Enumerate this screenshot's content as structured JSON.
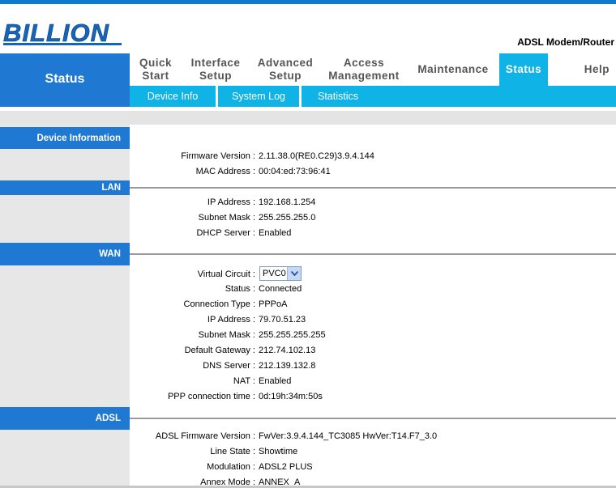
{
  "brand": {
    "logo_text": "BILLION",
    "tagline": "ADSL Modem/Router"
  },
  "nav": {
    "current": "Status",
    "items": [
      {
        "label": "Quick\nStart"
      },
      {
        "label": "Interface\nSetup"
      },
      {
        "label": "Advanced\nSetup"
      },
      {
        "label": "Access\nManagement"
      },
      {
        "label": "Maintenance"
      },
      {
        "label": "Status",
        "active": true
      },
      {
        "label": "Help"
      }
    ],
    "sub": [
      "Device Info",
      "System Log",
      "Statistics"
    ]
  },
  "sections": {
    "device": {
      "title": "Device Information",
      "rows": [
        {
          "label": "Firmware Version :",
          "value": "2.11.38.0(RE0.C29)3.9.4.144"
        },
        {
          "label": "MAC Address :",
          "value": "00:04:ed:73:96:41"
        }
      ]
    },
    "lan": {
      "title": "LAN",
      "rows": [
        {
          "label": "IP Address :",
          "value": "192.168.1.254"
        },
        {
          "label": "Subnet Mask :",
          "value": "255.255.255.0"
        },
        {
          "label": "DHCP Server :",
          "value": "Enabled"
        }
      ]
    },
    "wan": {
      "title": "WAN",
      "virtual_circuit_label": "Virtual Circuit :",
      "virtual_circuit_value": "PVC0",
      "rows": [
        {
          "label": "Status :",
          "value": "Connected"
        },
        {
          "label": "Connection Type :",
          "value": "PPPoA"
        },
        {
          "label": "IP Address :",
          "value": "79.70.51.23"
        },
        {
          "label": "Subnet Mask :",
          "value": "255.255.255.255"
        },
        {
          "label": "Default Gateway :",
          "value": "212.74.102.13"
        },
        {
          "label": "DNS Server :",
          "value": "212.139.132.8"
        },
        {
          "label": "NAT :",
          "value": "Enabled"
        },
        {
          "label": "PPP connection time :",
          "value": "0d:19h:34m:50s"
        }
      ]
    },
    "adsl": {
      "title": "ADSL",
      "rows": [
        {
          "label": "ADSL Firmware Version :",
          "value": "FwVer:3.9.4.144_TC3085 HwVer:T14.F7_3.0"
        },
        {
          "label": "Line State :",
          "value": "Showtime"
        },
        {
          "label": "Modulation :",
          "value": "ADSL2 PLUS"
        },
        {
          "label": "Annex Mode :",
          "value": "ANNEX_A"
        }
      ]
    }
  },
  "colors": {
    "primary_blue": "#1f78d1",
    "accent_cyan": "#0fb3e6",
    "left_gray": "#e7e7e7"
  }
}
